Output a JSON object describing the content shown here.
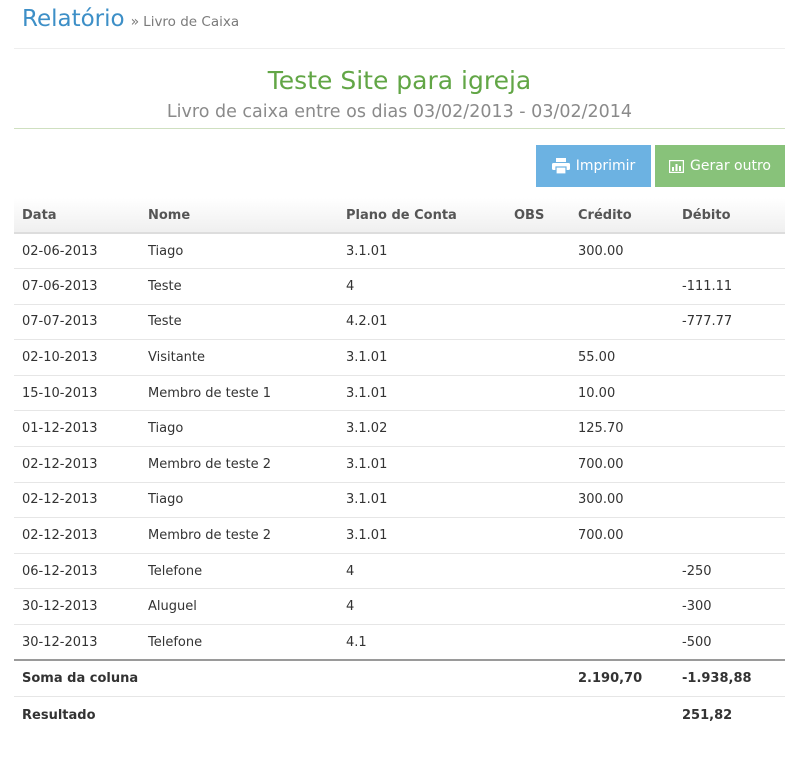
{
  "header": {
    "title": "Relatório",
    "separator": "»",
    "crumb": "Livro de Caixa"
  },
  "report": {
    "title": "Teste Site para igreja",
    "subtitle": "Livro de caixa entre os dias 03/02/2013 - 03/02/2014"
  },
  "buttons": {
    "print": "Imprimir",
    "generate": "Gerar outro"
  },
  "table": {
    "headers": {
      "date": "Data",
      "name": "Nome",
      "plan": "Plano de Conta",
      "obs": "OBS",
      "credit": "Crédito",
      "debit": "Débito"
    },
    "rows": [
      {
        "date": "02-06-2013",
        "name": "Tiago",
        "plan": "3.1.01",
        "obs": "",
        "credit": "300.00",
        "debit": ""
      },
      {
        "date": "07-06-2013",
        "name": "Teste",
        "plan": "4",
        "obs": "",
        "credit": "",
        "debit": "-111.11"
      },
      {
        "date": "07-07-2013",
        "name": "Teste",
        "plan": "4.2.01",
        "obs": "",
        "credit": "",
        "debit": "-777.77"
      },
      {
        "date": "02-10-2013",
        "name": "Visitante",
        "plan": "3.1.01",
        "obs": "",
        "credit": "55.00",
        "debit": ""
      },
      {
        "date": "15-10-2013",
        "name": "Membro de teste 1",
        "plan": "3.1.01",
        "obs": "",
        "credit": "10.00",
        "debit": ""
      },
      {
        "date": "01-12-2013",
        "name": "Tiago",
        "plan": "3.1.02",
        "obs": "",
        "credit": "125.70",
        "debit": ""
      },
      {
        "date": "02-12-2013",
        "name": "Membro de teste 2",
        "plan": "3.1.01",
        "obs": "",
        "credit": "700.00",
        "debit": ""
      },
      {
        "date": "02-12-2013",
        "name": "Tiago",
        "plan": "3.1.01",
        "obs": "",
        "credit": "300.00",
        "debit": ""
      },
      {
        "date": "02-12-2013",
        "name": "Membro de teste 2",
        "plan": "3.1.01",
        "obs": "",
        "credit": "700.00",
        "debit": ""
      },
      {
        "date": "06-12-2013",
        "name": "Telefone",
        "plan": "4",
        "obs": "",
        "credit": "",
        "debit": "-250"
      },
      {
        "date": "30-12-2013",
        "name": "Aluguel",
        "plan": "4",
        "obs": "",
        "credit": "",
        "debit": "-300"
      },
      {
        "date": "30-12-2013",
        "name": "Telefone",
        "plan": "4.1",
        "obs": "",
        "credit": "",
        "debit": "-500"
      }
    ],
    "sum": {
      "label": "Soma da coluna",
      "credit": "2.190,70",
      "debit": "-1.938,88"
    },
    "result": {
      "label": "Resultado",
      "value": "251,82"
    }
  },
  "colors": {
    "title_blue": "#3d8fc7",
    "report_green": "#62a646",
    "print_button": "#6cb2e2",
    "generate_button": "#88c27a"
  },
  "icons": {
    "print": "printer-icon",
    "generate": "chart-icon"
  }
}
